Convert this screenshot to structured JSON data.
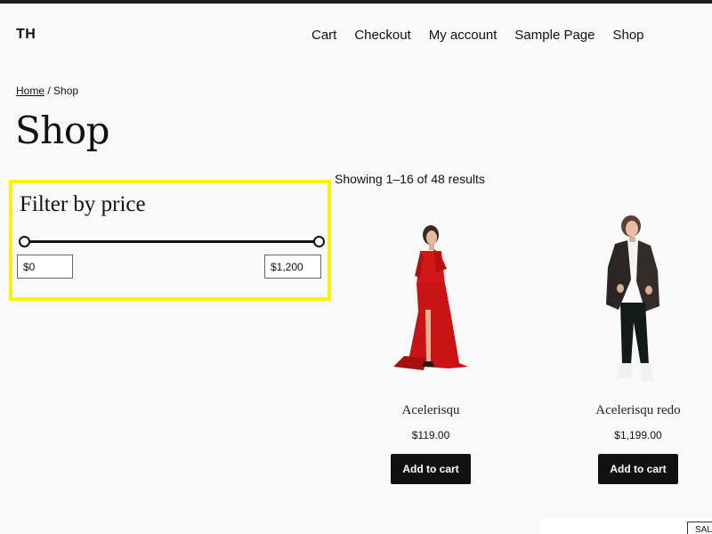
{
  "header": {
    "site_title": "TH",
    "nav": [
      "Cart",
      "Checkout",
      "My account",
      "Sample Page",
      "Shop"
    ]
  },
  "breadcrumb": {
    "home": "Home",
    "separator": " / ",
    "current": "Shop"
  },
  "page_title": "Shop",
  "filter": {
    "title": "Filter by price",
    "min_value": "$0",
    "max_value": "$1,200",
    "highlight_color": "#fff200"
  },
  "results": {
    "count_text": "Showing 1–16 of 48 results"
  },
  "products": [
    {
      "name": "Acelerisqu",
      "price": "$119.00",
      "button": "Add to cart",
      "image_icon": "woman-red-dress-image"
    },
    {
      "name": "Acelerisqu redo",
      "price": "$1,199.00",
      "button": "Add to cart",
      "image_icon": "woman-leather-jacket-image"
    }
  ],
  "sale_badge": "SAL"
}
